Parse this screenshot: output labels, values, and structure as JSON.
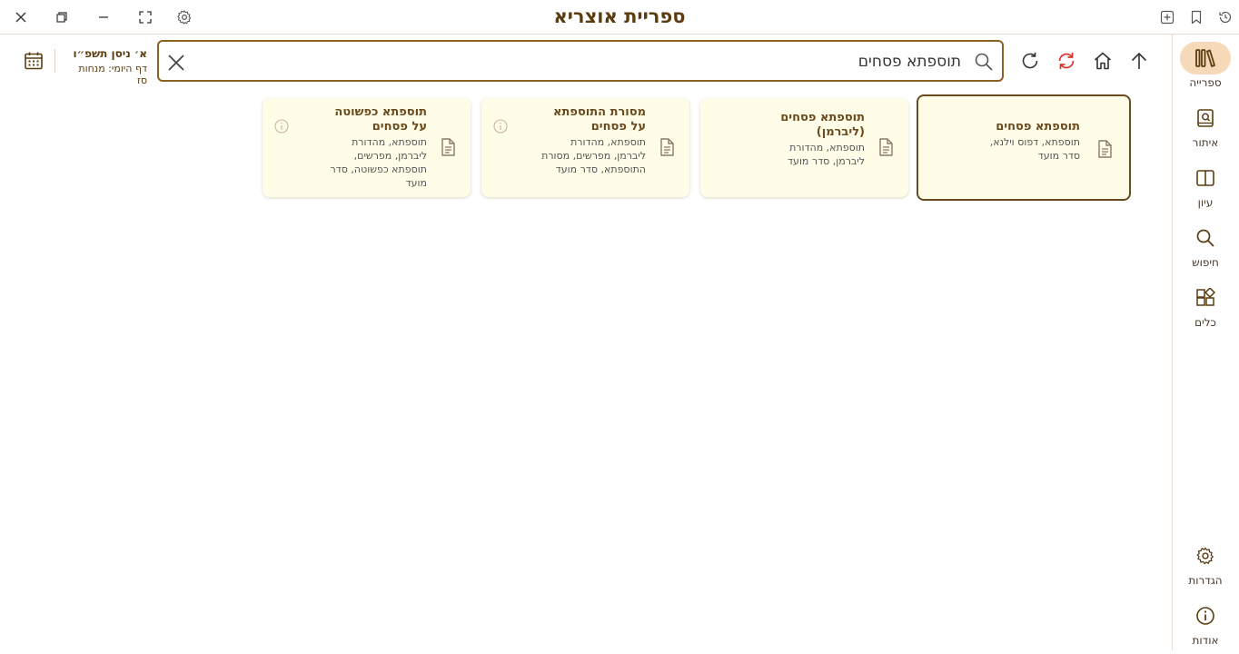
{
  "app": {
    "title": "ספריית אוצריא"
  },
  "sidebar": {
    "items": [
      {
        "label": "ספרייה",
        "icon": "library-icon"
      },
      {
        "label": "איתור",
        "icon": "find-book-icon"
      },
      {
        "label": "עיון",
        "icon": "open-book-icon"
      },
      {
        "label": "חיפוש",
        "icon": "search-icon"
      },
      {
        "label": "כלים",
        "icon": "tools-icon"
      }
    ],
    "bottom": [
      {
        "label": "הגדרות",
        "icon": "gear-icon"
      },
      {
        "label": "אודות",
        "icon": "info-icon"
      }
    ]
  },
  "search": {
    "value": "תוספתא פסחים"
  },
  "date": {
    "hebrew": "א׳ ניסן תשפ״ו",
    "daf_yomi": "דף היומי: מנחות סז"
  },
  "cards": [
    {
      "title_lines": [
        "תוספתא פסחים"
      ],
      "desc_lines": [
        "תוספתא, דפוס וילנא,",
        "סדר מועד"
      ],
      "has_info": false,
      "selected": true
    },
    {
      "title_lines": [
        "תוספתא פסחים",
        "(ליברמן)"
      ],
      "desc_lines": [
        "תוספתא, מהדורת",
        "ליברמן, סדר מועד"
      ],
      "has_info": false,
      "selected": false
    },
    {
      "title_lines": [
        "מסורת התוספתא",
        "על פסחים"
      ],
      "desc_lines": [
        "תוספתא, מהדורת",
        "ליברמן, מפרשים, מסורת",
        "התוספתא, סדר מועד"
      ],
      "has_info": true,
      "selected": false
    },
    {
      "title_lines": [
        "תוספתא כפשוטה",
        "על פסחים"
      ],
      "desc_lines": [
        "תוספתא, מהדורת",
        "ליברמן, מפרשים,",
        "תוספתא כפשוטה, סדר",
        "מועד"
      ],
      "has_info": true,
      "selected": false
    }
  ],
  "colors": {
    "accent": "#5c3d11",
    "card_bg": "#fffde8",
    "sync_red": "#d9372b",
    "active_bg": "#f5d9b8"
  }
}
